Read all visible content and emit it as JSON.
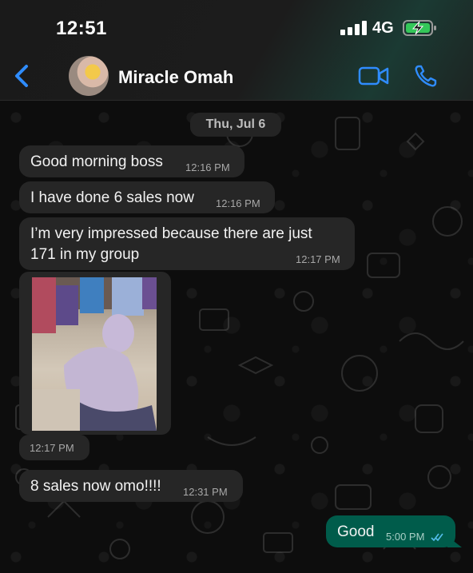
{
  "status_bar": {
    "time": "12:51",
    "network": "4G"
  },
  "header": {
    "contact_name": "Miracle Omah"
  },
  "chat": {
    "date_divider": "Thu, Jul 6",
    "messages": [
      {
        "text": "Good morning boss",
        "time": "12:16 PM"
      },
      {
        "text": "I have done 6 sales now",
        "time": "12:16 PM"
      },
      {
        "text_line1": "I’m very impressed because there are just",
        "text_line2": "171 in my group",
        "time": "12:17 PM"
      },
      {
        "type": "image",
        "time": "12:17 PM"
      },
      {
        "text": "8 sales now omo!!!!",
        "time": "12:31 PM"
      },
      {
        "text": "Good",
        "time": "5:00 PM"
      }
    ]
  },
  "colors": {
    "accent_blue": "#2f8cff",
    "incoming_bubble": "#262626",
    "outgoing_bubble": "#005c4b",
    "battery_green": "#34c759"
  },
  "icons": {
    "back": "chevron-left-icon",
    "video": "video-camera-icon",
    "phone": "phone-icon",
    "read_receipt": "double-check-icon"
  }
}
